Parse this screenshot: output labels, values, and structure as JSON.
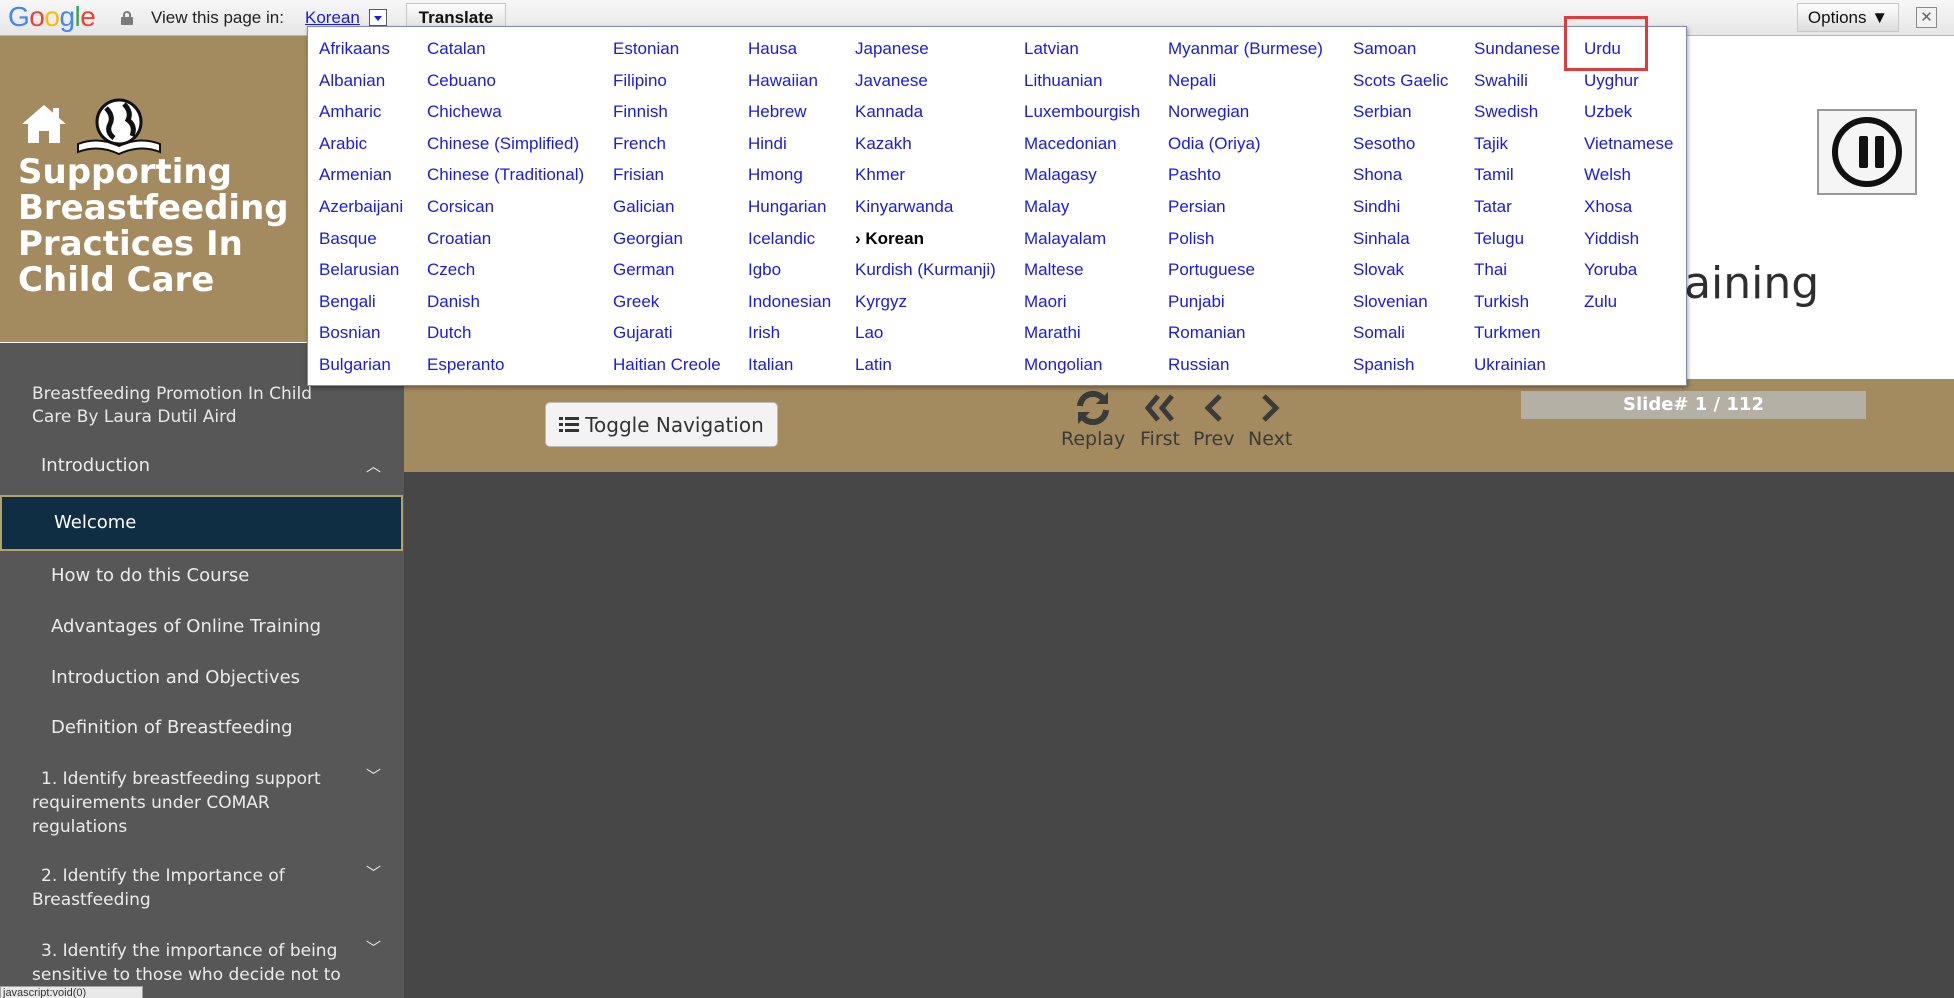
{
  "translate_bar": {
    "logo_letters": [
      {
        "ch": "G",
        "color": "#4285f4"
      },
      {
        "ch": "o",
        "color": "#ea4335"
      },
      {
        "ch": "o",
        "color": "#fbbc05"
      },
      {
        "ch": "g",
        "color": "#4285f4"
      },
      {
        "ch": "l",
        "color": "#34a853"
      },
      {
        "ch": "e",
        "color": "#ea4335"
      }
    ],
    "view_label": "View this page in:",
    "current_language": "Korean",
    "translate_label": "Translate",
    "options_label": "Options ▼",
    "close_label": "✕"
  },
  "languages": {
    "columns": [
      [
        "Afrikaans",
        "Albanian",
        "Amharic",
        "Arabic",
        "Armenian",
        "Azerbaijani",
        "Basque",
        "Belarusian",
        "Bengali",
        "Bosnian",
        "Bulgarian"
      ],
      [
        "Catalan",
        "Cebuano",
        "Chichewa",
        "Chinese (Simplified)",
        "Chinese (Traditional)",
        "Corsican",
        "Croatian",
        "Czech",
        "Danish",
        "Dutch",
        "Esperanto"
      ],
      [
        "Estonian",
        "Filipino",
        "Finnish",
        "French",
        "Frisian",
        "Galician",
        "Georgian",
        "German",
        "Greek",
        "Gujarati",
        "Haitian Creole"
      ],
      [
        "Hausa",
        "Hawaiian",
        "Hebrew",
        "Hindi",
        "Hmong",
        "Hungarian",
        "Icelandic",
        "Igbo",
        "Indonesian",
        "Irish",
        "Italian"
      ],
      [
        "Japanese",
        "Javanese",
        "Kannada",
        "Kazakh",
        "Khmer",
        "Kinyarwanda",
        "› Korean",
        "Kurdish (Kurmanji)",
        "Kyrgyz",
        "Lao",
        "Latin"
      ],
      [
        "Latvian",
        "Lithuanian",
        "Luxembourgish",
        "Macedonian",
        "Malagasy",
        "Malay",
        "Malayalam",
        "Maltese",
        "Maori",
        "Marathi",
        "Mongolian"
      ],
      [
        "Myanmar (Burmese)",
        "Nepali",
        "Norwegian",
        "Odia (Oriya)",
        "Pashto",
        "Persian",
        "Polish",
        "Portuguese",
        "Punjabi",
        "Romanian",
        "Russian"
      ],
      [
        "Samoan",
        "Scots Gaelic",
        "Serbian",
        "Sesotho",
        "Shona",
        "Sindhi",
        "Sinhala",
        "Slovak",
        "Slovenian",
        "Somali",
        "Spanish"
      ],
      [
        "Sundanese",
        "Swahili",
        "Swedish",
        "Tajik",
        "Tamil",
        "Tatar",
        "Telugu",
        "Thai",
        "Turkish",
        "Turkmen",
        "Ukrainian"
      ],
      [
        "Urdu",
        "Uyghur",
        "Uzbek",
        "Vietnamese",
        "Welsh",
        "Xhosa",
        "Yiddish",
        "Yoruba",
        "Zulu"
      ]
    ],
    "selected": "› Korean",
    "highlighted": "Urdu",
    "link_color": "#1a1ae6",
    "highlight_color": "#e03a3a"
  },
  "course": {
    "title": "Supporting Breastfeeding Practices In Child Care",
    "partial_heading": "raining",
    "home_icon": "home-icon",
    "globe_icon": "globe-book-icon",
    "pause_icon": "pause-icon",
    "brand_color": "#a38b5f"
  },
  "controls": {
    "toggle_label": "Toggle Navigation",
    "replay": "Replay",
    "first": "First",
    "prev": "Prev",
    "next": "Next",
    "slide": "Slide# 1 / 112"
  },
  "sidebar": {
    "course_name": "Breastfeeding Promotion In Child Care By Laura Dutil Aird",
    "section": "Introduction",
    "items": [
      "Welcome",
      "How to do this Course",
      "Advantages of Online Training",
      "Introduction and Objectives",
      "Definition of Breastfeeding"
    ],
    "objectives": [
      "1. Identify breastfeeding support requirements under COMAR regulations",
      "2. Identify the Importance of Breastfeeding",
      "3. Identify the importance of being sensitive to those who decide not to"
    ],
    "active_color": "#0f2e44"
  },
  "status": "javascript:void(0)"
}
